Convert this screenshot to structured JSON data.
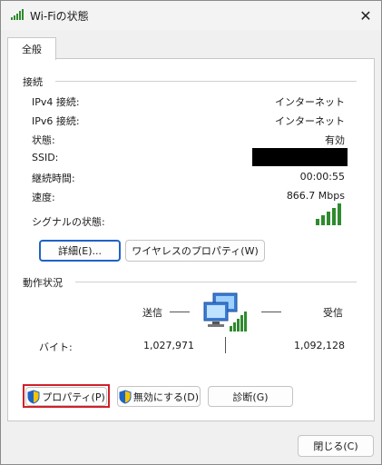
{
  "window": {
    "title": "Wi-Fiの状態",
    "close_glyph": "✕"
  },
  "tabs": [
    {
      "label": "全般"
    }
  ],
  "connection": {
    "heading": "接続",
    "rows": [
      {
        "label": "IPv4 接続:",
        "value": "インターネット"
      },
      {
        "label": "IPv6 接続:",
        "value": "インターネット"
      },
      {
        "label": "状態:",
        "value": "有効"
      },
      {
        "label": "SSID:",
        "value": ""
      },
      {
        "label": "継続時間:",
        "value": "00:00:55"
      },
      {
        "label": "速度:",
        "value": "866.7 Mbps"
      }
    ],
    "signal_label": "シグナルの状態:",
    "signal_bars": 5,
    "details_button": "詳細(E)...",
    "wireless_props_button": "ワイヤレスのプロパティ(W)"
  },
  "activity": {
    "heading": "動作状況",
    "sent_label": "送信",
    "received_label": "受信",
    "bytes_label": "バイト:",
    "bytes_sent": "1,027,971",
    "bytes_received": "1,092,128"
  },
  "actions": {
    "properties_button": "プロパティ(P)",
    "disable_button": "無効にする(D)",
    "diagnose_button": "診断(G)"
  },
  "footer": {
    "close_button": "閉じる(C)"
  },
  "colors": {
    "accent": "#1f63c6",
    "highlight": "#d0202a",
    "signal_green": "#2e8b2e"
  },
  "icons": [
    "wifi-signal-icon",
    "close-icon",
    "network-computers-icon",
    "shield-icon"
  ]
}
